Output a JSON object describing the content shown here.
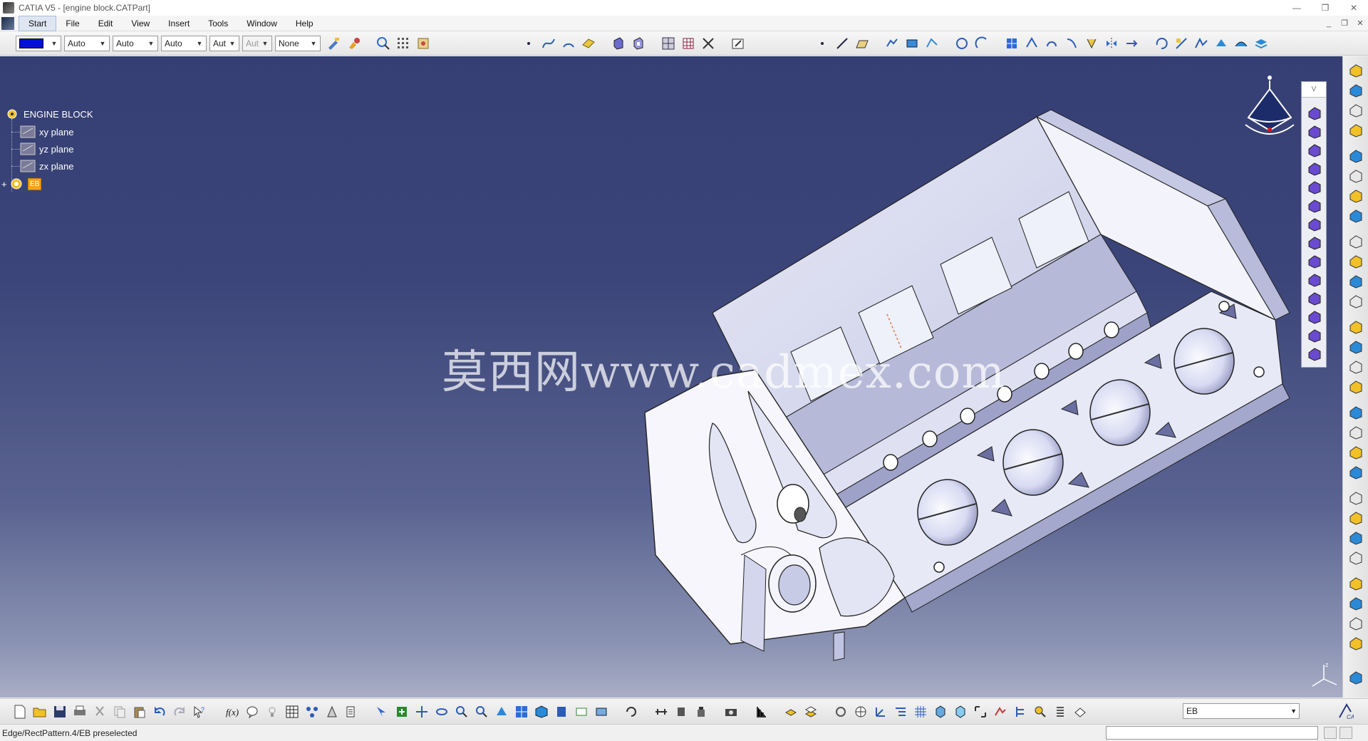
{
  "window": {
    "title": "CATIA V5 - [engine block.CATPart]",
    "controls": [
      "—",
      "❐",
      "✕"
    ],
    "mdi_controls": [
      "_",
      "❐",
      "✕"
    ]
  },
  "menu": {
    "items": [
      "Start",
      "File",
      "Edit",
      "View",
      "Insert",
      "Tools",
      "Window",
      "Help"
    ],
    "active": "Start"
  },
  "graphic_properties": {
    "color_value": "#0010d8",
    "transparency": "Auto",
    "line_thickness": "Auto",
    "line_type": "Auto",
    "point_symbol": "Aut",
    "render_style": "Aut",
    "layer": "None"
  },
  "spec_tree": {
    "root": "ENGINE BLOCK",
    "planes": [
      "xy plane",
      "yz plane",
      "zx plane"
    ],
    "body_badge": "EB",
    "expand_symbol": "+"
  },
  "watermark": {
    "text": "莫西网www.cadmex.com"
  },
  "float_toolbar": {
    "title": "V"
  },
  "bottom_toolbar": {
    "current_body": "EB"
  },
  "status": {
    "message": "Edge/RectPattern.4/EB preselected"
  },
  "colors": {
    "viewport_top": "#353f74",
    "viewport_bottom": "#a9aec5",
    "part_fill": "#d9dbef",
    "part_shadow": "#9fa3c5",
    "compass_red": "#e01010"
  },
  "icons": {
    "top": [
      "fill-color-icon",
      "paint-brush-icon",
      "query-icon",
      "grid-icon",
      "snap-icon",
      "point-icon",
      "spline-icon",
      "arc-icon",
      "plane-icon",
      "pad-icon",
      "pocket-icon",
      "multi-view-icon",
      "table-icon",
      "sketch-tools-icon",
      "sketch-icon",
      "dot-icon",
      "line-icon",
      "parallelogram-icon",
      "profile-icon",
      "rectangle-icon",
      "polyline-icon",
      "circle-icon",
      "arc-tool-icon",
      "constraint-icon",
      "projection-icon",
      "trim-icon",
      "offset-icon",
      "corner-icon",
      "mirror-icon",
      "translate-icon",
      "rotate-icon",
      "scale-icon",
      "analysis-icon"
    ],
    "bottom": [
      "new-file-icon",
      "open-file-icon",
      "save-icon",
      "print-icon",
      "cut-icon",
      "copy-icon",
      "paste-icon",
      "undo-icon",
      "redo-icon",
      "whats-this-icon",
      "formula-icon",
      "knowledge-icon",
      "table-icon",
      "design-table-icon",
      "catalog-icon",
      "publication-icon",
      "select-icon",
      "fit-all-icon",
      "pan-icon",
      "rotate-icon",
      "zoom-in-icon",
      "zoom-out-icon",
      "normal-view-icon",
      "quick-view-icon",
      "iso-view-icon",
      "render-style-icon",
      "hide-show-icon",
      "swap-space-icon",
      "update-icon",
      "measure-icon",
      "camera-icon",
      "inertia-icon",
      "axis-system-icon",
      "body-icon",
      "boolean-icon",
      "repetition-icon",
      "reference-icon",
      "compass-icon",
      "grid-icon",
      "sketch-icon",
      "dress-up-icon",
      "surface-icon",
      "analysis-icon",
      "tree-icon",
      "search-icon",
      "list-icon",
      "part-icon"
    ],
    "right": [
      "sketcher-icon",
      "select-arrow-icon",
      "constraint-icon",
      "profile-icon",
      "text-icon",
      "dimension-icon",
      "measure-icon",
      "fillet-icon",
      "chamfer-icon",
      "draft-icon",
      "shell-icon",
      "thickness-icon",
      "thread-icon",
      "remove-face-icon",
      "replace-face-icon",
      "mirror-icon",
      "pattern-icon",
      "scale-icon",
      "boolean-icon",
      "add-icon",
      "remove-icon",
      "intersect-icon",
      "union-trim-icon",
      "remove-lump-icon",
      "axis-icon",
      "plane-icon",
      "point-icon",
      "line-icon",
      "catia-logo-icon"
    ],
    "float": [
      "pad-icon",
      "drafted-pad-icon",
      "multi-pad-icon",
      "pocket-icon",
      "drafted-pocket-icon",
      "multi-pocket-icon",
      "shaft-icon",
      "groove-icon",
      "hole-icon",
      "rib-icon",
      "slot-icon",
      "stiffener-icon",
      "loft-icon",
      "removed-loft-icon"
    ]
  }
}
